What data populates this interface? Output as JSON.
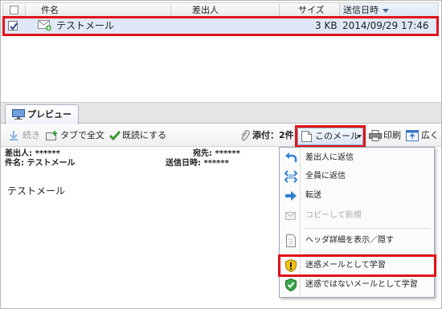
{
  "mail_list": {
    "columns": {
      "subject": "件名",
      "sender": "差出人",
      "size": "サイズ",
      "sent_datetime": "送信日時"
    },
    "rows": [
      {
        "checked": true,
        "icon": "mail-attachment-icon",
        "subject": "テストメール",
        "size": "3 KB",
        "sent_datetime": "2014/09/29 17:46"
      }
    ]
  },
  "preview": {
    "tab_label": "プレビュー",
    "toolbar": {
      "continue": "続き",
      "full_text_in_tab": "タブで全文",
      "mark_as_read": "既読にする",
      "attachments": "添付：2件",
      "this_mail": "このメール",
      "print": "印刷",
      "expand": "広く"
    },
    "header": {
      "from_label": "差出人:",
      "from_value": "******",
      "to_label": "宛先:",
      "to_value": "******",
      "subject_label": "件名:",
      "subject_value": "テストメール",
      "sent_label": "送信日時:",
      "sent_value": "******"
    },
    "body": "テストメール"
  },
  "mail_menu": {
    "items": [
      {
        "label": "差出人に返信",
        "icon": "reply-icon",
        "enabled": true
      },
      {
        "label": "全員に返信",
        "icon": "reply-all-icon",
        "enabled": true
      },
      {
        "label": "転送",
        "icon": "forward-icon",
        "enabled": true
      },
      {
        "label": "コピーして新規",
        "icon": "copy-new-icon",
        "enabled": false
      },
      {
        "label": "ヘッダ詳細を表示／隠す",
        "icon": "document-icon",
        "enabled": true
      },
      {
        "label": "迷惑メールとして学習",
        "icon": "spam-shield-icon",
        "enabled": true
      },
      {
        "label": "迷惑ではないメールとして学習",
        "icon": "not-spam-shield-icon",
        "enabled": true
      }
    ]
  },
  "colors": {
    "highlight": "#e2121b",
    "selected_row": "#dfe8f6",
    "accent": "#3a78c9"
  }
}
